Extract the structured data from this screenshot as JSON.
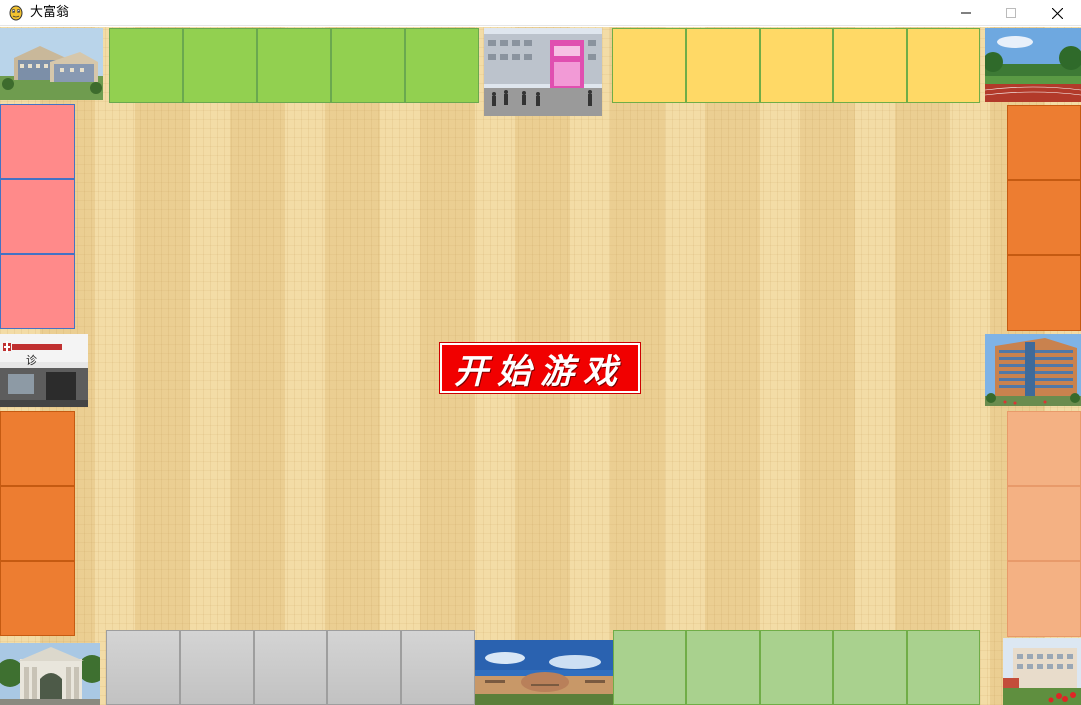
{
  "window": {
    "title": "大富翁",
    "app_icon": "python-snake-icon",
    "controls": [
      "minimize-icon",
      "maximize-icon",
      "close-icon"
    ]
  },
  "board": {
    "start_button_label": "开始游戏",
    "colors": {
      "top_left_group": "#92d050",
      "top_right_group": "#ffd966",
      "left_top_group": "#ff8a8a",
      "left_bottom_group": "#ed7d31",
      "right_top_group": "#ed7d31",
      "right_bottom_group": "#f4b183",
      "bottom_left_group": "#c8c8c8",
      "bottom_right_group": "#a9d18e",
      "start_button": "#f10000"
    },
    "corner_photos": [
      "campus-building-photo",
      "plaza-poster-photo",
      "sports-field-photo",
      "clinic-building-photo",
      "office-tower-photo",
      "school-gate-photo",
      "auditorium-photo",
      "library-photo"
    ],
    "clinic_sign_char": "诊"
  }
}
